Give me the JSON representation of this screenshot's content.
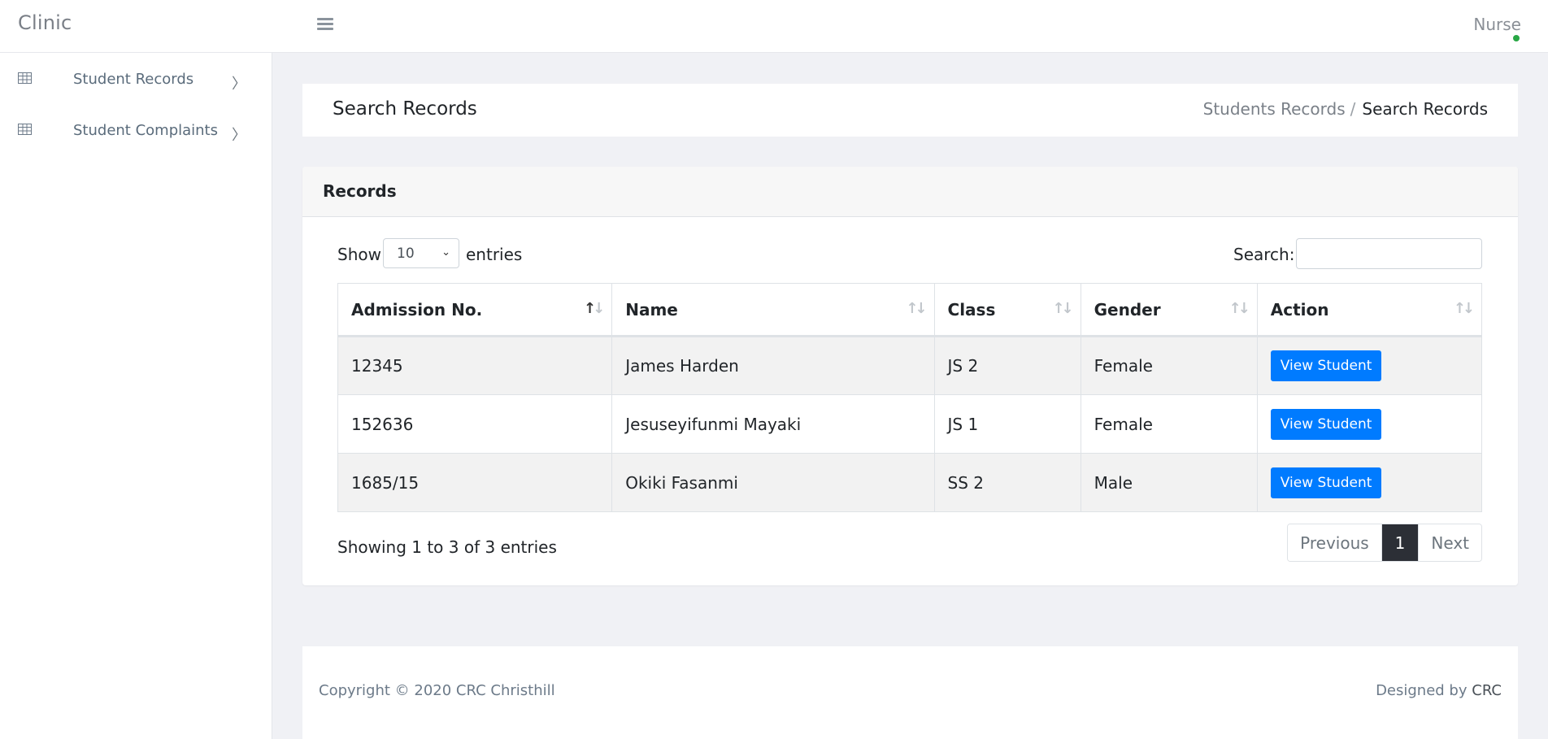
{
  "app": {
    "brand": "Clinic",
    "user": "Nurse",
    "status_color": "#28a745"
  },
  "sidebar": {
    "items": [
      {
        "label": "Student Records",
        "icon": "table-icon"
      },
      {
        "label": "Student Complaints",
        "icon": "table-icon"
      }
    ]
  },
  "header": {
    "title": "Search Records",
    "breadcrumb": {
      "parent": "Students Records",
      "separator": "/",
      "current": "Search Records"
    }
  },
  "card": {
    "title": "Records"
  },
  "length": {
    "show": "Show",
    "value": "10",
    "entries": "entries"
  },
  "search": {
    "label": "Search:",
    "value": ""
  },
  "table": {
    "columns": [
      "Admission No.",
      "Name",
      "Class",
      "Gender",
      "Action"
    ],
    "rows": [
      {
        "admission": "12345",
        "name": "James Harden",
        "class": "JS 2",
        "gender": "Female",
        "action": "View Student"
      },
      {
        "admission": "152636",
        "name": "Jesuseyifunmi Mayaki",
        "class": "JS 1",
        "gender": "Female",
        "action": "View Student"
      },
      {
        "admission": "1685/15",
        "name": "Okiki Fasanmi",
        "class": "SS 2",
        "gender": "Male",
        "action": "View Student"
      }
    ]
  },
  "info": "Showing 1 to 3 of 3 entries",
  "pagination": {
    "previous": "Previous",
    "current": "1",
    "next": "Next"
  },
  "footer": {
    "copyright": "Copyright © 2020 CRC Christhill",
    "designed_by": "Designed by",
    "designer": "CRC"
  },
  "colors": {
    "primary": "#007bff",
    "page_active": "#2c2f36"
  }
}
